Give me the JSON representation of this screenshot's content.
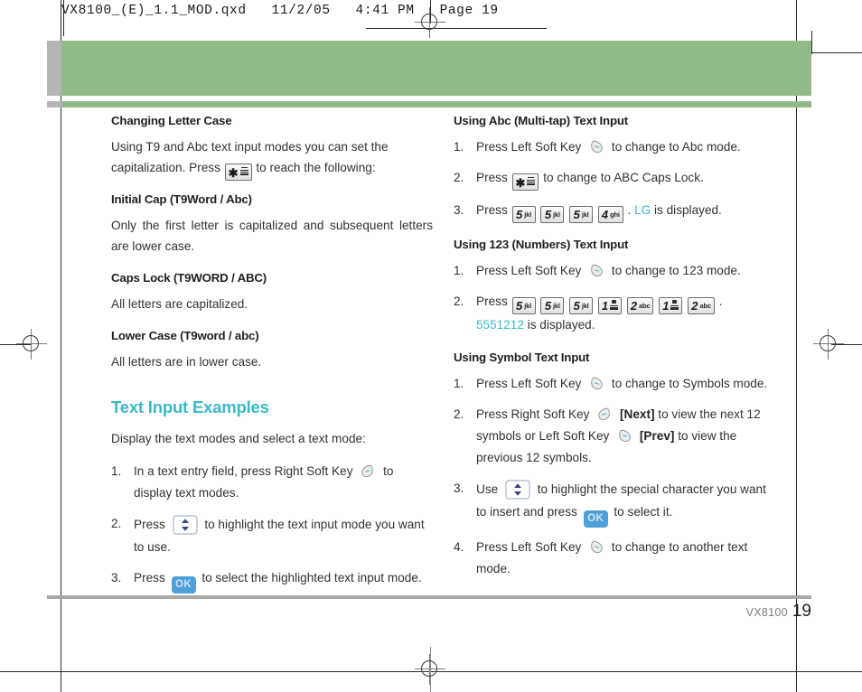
{
  "prepress": {
    "file_header": "VX8100_(E)_1.1_MOD.qxd   11/2/05   4:41 PM   Page 19",
    "band_color": "#91ba88",
    "tab_color": "#b5b5b5"
  },
  "accent_color": "#3bb8c9",
  "left_column": {
    "s1": {
      "heading": "Changing Letter Case",
      "body_a": "Using T9 and Abc text input modes you can set the",
      "body_b": "capitalization. Press",
      "body_c": "to reach the following:"
    },
    "s2": {
      "heading": "Initial Cap (T9Word / Abc)",
      "body": "Only the first letter is capitalized and subsequent letters are lower case."
    },
    "s3": {
      "heading": "Caps Lock (T9WORD / ABC)",
      "body": "All letters are capitalized."
    },
    "s4": {
      "heading": "Lower Case (T9word / abc)",
      "body": "All letters are in lower case."
    },
    "s5": {
      "heading": "Text Input Examples",
      "intro": "Display the text modes and select a text mode:",
      "steps": [
        {
          "num": "1.",
          "t1": "In a text entry field, press Right Soft Key",
          "t2": "to display text modes."
        },
        {
          "num": "2.",
          "t1": "Press",
          "t2": "to highlight the text input mode you want to use."
        },
        {
          "num": "3.",
          "t1": "Press",
          "t2": "to select the highlighted text input mode."
        }
      ]
    }
  },
  "right_column": {
    "s1": {
      "heading": "Using Abc (Multi-tap) Text Input",
      "steps": [
        {
          "num": "1.",
          "t1": "Press Left Soft Key",
          "t2": "to change to Abc mode."
        },
        {
          "num": "2.",
          "t1": "Press",
          "t2": "to change to ABC Caps Lock."
        },
        {
          "num": "3.",
          "t1": "Press",
          "t2": ".",
          "result": "LG",
          "t3": "is displayed."
        }
      ],
      "keys_step3": [
        {
          "digit": "5",
          "letters": "jkl"
        },
        {
          "digit": "5",
          "letters": "jkl"
        },
        {
          "digit": "5",
          "letters": "jkl"
        },
        {
          "digit": "4",
          "letters": "ghi"
        }
      ]
    },
    "s2": {
      "heading": "Using 123 (Numbers) Text Input",
      "steps": [
        {
          "num": "1.",
          "t1": "Press Left Soft Key",
          "t2": "to change to 123 mode."
        },
        {
          "num": "2.",
          "t1": "Press",
          "t2": ".",
          "result": "5551212",
          "t3": "is displayed."
        }
      ],
      "keys_step2": [
        {
          "digit": "5",
          "letters": "jkl"
        },
        {
          "digit": "5",
          "letters": "jkl"
        },
        {
          "digit": "5",
          "letters": "jkl"
        },
        {
          "digit": "1",
          "letters": ""
        },
        {
          "digit": "2",
          "letters": "abc"
        },
        {
          "digit": "1",
          "letters": ""
        },
        {
          "digit": "2",
          "letters": "abc"
        }
      ]
    },
    "s3": {
      "heading": "Using Symbol Text Input",
      "steps": [
        {
          "num": "1.",
          "t1": "Press Left Soft Key",
          "t2": "to change to Symbols mode."
        },
        {
          "num": "2.",
          "t1": "Press Right Soft Key",
          "label_next": "[Next]",
          "t2": "to view the next 12 symbols or Left Soft Key",
          "label_prev": "[Prev]",
          "t3": "to view the previous 12 symbols."
        },
        {
          "num": "3.",
          "t1": "Use",
          "t2": "to highlight the special character you want to insert and press",
          "t3": "to select it."
        },
        {
          "num": "4.",
          "t1": "Press Left Soft Key",
          "t2": "to change to another text mode."
        }
      ]
    }
  },
  "footer": {
    "model": "VX8100",
    "page_number": "19"
  }
}
